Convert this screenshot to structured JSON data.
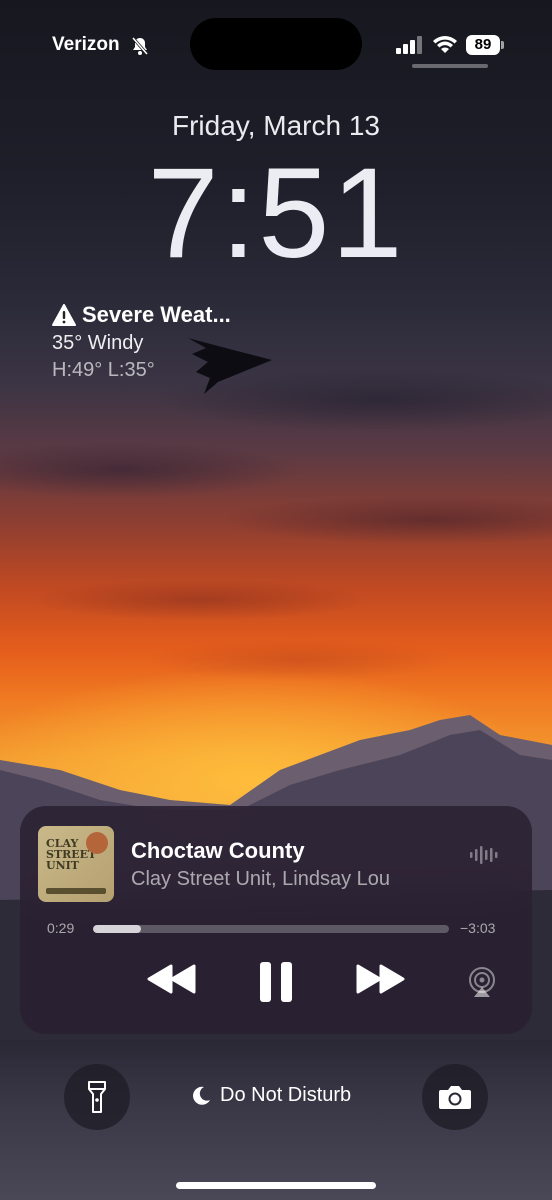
{
  "status_bar": {
    "carrier": "Verizon",
    "battery": "89",
    "icons": [
      "bell-slash-icon",
      "signal-icon",
      "wifi-icon",
      "battery-icon"
    ]
  },
  "lock_screen": {
    "date": "Friday, March 13",
    "time": "7:51"
  },
  "weather_widget": {
    "alert": "Severe Weat...",
    "condition": "35° Windy",
    "high_low": "H:49° L:35°",
    "icon": "warning-icon"
  },
  "now_playing": {
    "title": "Choctaw County",
    "artist": "Clay Street Unit, Lindsay Lou",
    "elapsed": "0:29",
    "remaining": "−3:03",
    "progress_fraction": 0.135,
    "album_art_text": "CLAY STREET UNIT"
  },
  "bottom": {
    "focus_label": "Do Not Disturb",
    "left_button": "flashlight-icon",
    "right_button": "camera-icon"
  }
}
